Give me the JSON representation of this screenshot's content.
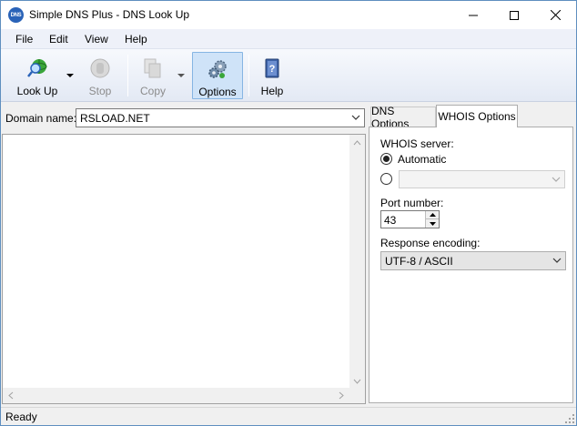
{
  "window": {
    "title": "Simple DNS Plus - DNS Look Up",
    "icon_text": "DNS",
    "controls": {
      "minimize": "minimize-icon",
      "maximize": "maximize-icon",
      "close": "close-icon"
    }
  },
  "menu": {
    "items": [
      {
        "label": "File"
      },
      {
        "label": "Edit"
      },
      {
        "label": "View"
      },
      {
        "label": "Help"
      }
    ]
  },
  "toolbar": {
    "lookup": {
      "label": "Look Up",
      "icon": "globe-search-icon",
      "enabled": true
    },
    "stop": {
      "label": "Stop",
      "icon": "stop-hand-icon",
      "enabled": false
    },
    "copy": {
      "label": "Copy",
      "icon": "copy-icon",
      "enabled": false
    },
    "options": {
      "label": "Options",
      "icon": "gears-icon",
      "enabled": true,
      "active": true
    },
    "help": {
      "label": "Help",
      "icon": "help-book-icon",
      "enabled": true
    }
  },
  "domain": {
    "label": "Domain name:",
    "value": "RSLOAD.NET"
  },
  "tabs": [
    {
      "label": "DNS Options",
      "selected": false
    },
    {
      "label": "WHOIS Options",
      "selected": true
    }
  ],
  "whois": {
    "server_label": "WHOIS server:",
    "automatic_label": "Automatic",
    "automatic_selected": true,
    "custom_selected": false,
    "custom_server_value": "",
    "port_label": "Port number:",
    "port_value": "43",
    "encoding_label": "Response encoding:",
    "encoding_value": "UTF-8 / ASCII"
  },
  "status": {
    "text": "Ready"
  },
  "colors": {
    "options_active_bg": "#cfe3f8",
    "options_active_border": "#86b5e3",
    "title_bar": "#ffffff",
    "accent": "#2a63b8"
  }
}
